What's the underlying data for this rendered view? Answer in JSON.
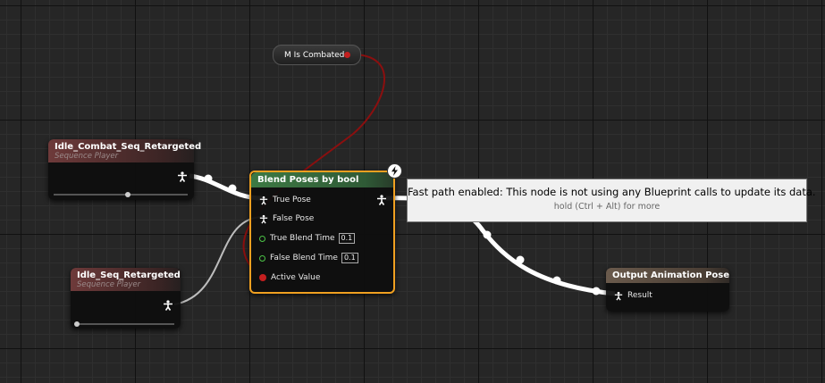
{
  "nodes": {
    "idle_combat": {
      "title": "Idle_Combat_Seq_Retargeted",
      "subtitle": "Sequence Player"
    },
    "idle": {
      "title": "Idle_Seq_Retargeted",
      "subtitle": "Sequence Player"
    },
    "is_combated": {
      "label": "M Is Combated"
    },
    "blend": {
      "title": "Blend Poses by bool",
      "pins": {
        "true_pose": "True Pose",
        "false_pose": "False Pose",
        "true_blend_time": "True Blend Time",
        "true_blend_time_value": "0.1",
        "false_blend_time": "False Blend Time",
        "false_blend_time_value": "0.1",
        "active_value": "Active Value"
      }
    },
    "output": {
      "title": "Output Animation Pose",
      "result_label": "Result"
    }
  },
  "tooltip": {
    "text": "Fast path enabled: This node is not using any Blueprint calls to update its data.",
    "hint": "hold (Ctrl + Alt) for more"
  },
  "icons": {
    "fast_path": "lightning-bolt-icon",
    "pose": "pose-figure-icon",
    "float_pin": "green-ring-icon",
    "bool_pin": "red-dot-icon"
  },
  "colors": {
    "canvas": "#262626",
    "grid": "#111111",
    "seq_header": "#6e3a3a",
    "blend_header": "#3d7a44",
    "output_header": "#6a5a4c",
    "selection": "#f0a020",
    "bool_wire": "#8b0f0f",
    "float_pin": "#4cc447",
    "tooltip_bg": "#f0f0f0"
  }
}
